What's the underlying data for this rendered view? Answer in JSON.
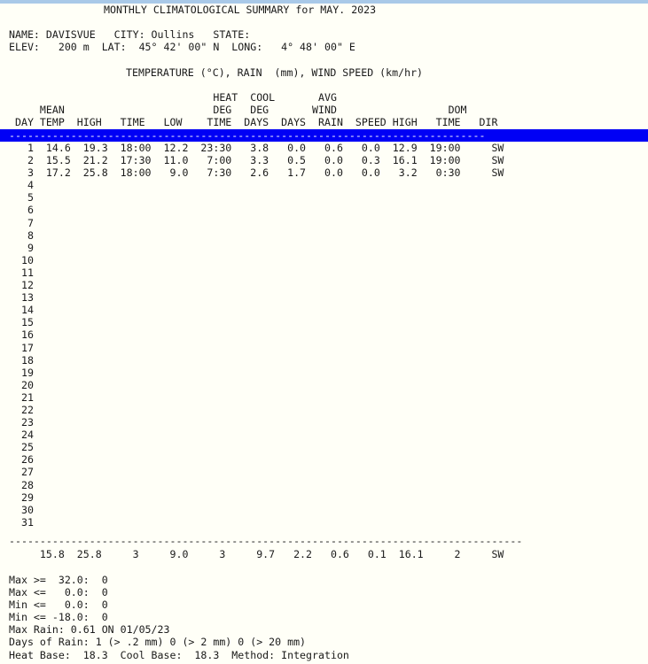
{
  "window": {
    "top_strip_color": "#a9c9e8",
    "background_color": "#fffff7",
    "text_color": "#1a1a1a",
    "selection_color": "#0000f5",
    "selection_text_color": "#ffffff"
  },
  "report": {
    "title": "MONTHLY CLIMATOLOGICAL SUMMARY for MAY. 2023",
    "station": {
      "name_label": "NAME:",
      "name_value": "DAVISVUE",
      "city_label": "CITY:",
      "city_value": "Oullins",
      "state_label": "STATE:",
      "state_value": "",
      "elev_label": "ELEV:",
      "elev_value": "200 m",
      "lat_label": "LAT:",
      "lat_value": "45° 42' 00\" N",
      "long_label": "LONG:",
      "long_value": "4° 48' 00\" E",
      "line1": "NAME: DAVISVUE   CITY: Oullins   STATE:",
      "line2": "ELEV:   200 m  LAT:  45° 42' 00\" N  LONG:   4° 48' 00\" E"
    },
    "units_line": "TEMPERATURE (°C), RAIN  (mm), WIND SPEED (km/hr)",
    "header_row_1": "                                 HEAT  COOL       AVG",
    "header_row_2": "     MEAN                        DEG   DEG       WIND                  DOM",
    "header_row_3": " DAY TEMP  HIGH   TIME   LOW    TIME  DAYS  DAYS  RAIN  SPEED HIGH   TIME   DIR",
    "separator_top": "-----------------------------------------------------------------------------",
    "separator_bottom": "-----------------------------------------------------------------------------------",
    "columns": [
      "DAY",
      "MEAN TEMP",
      "HIGH",
      "TIME",
      "LOW",
      "TIME",
      "HEAT DEG DAYS",
      "COOL DEG DAYS",
      "RAIN",
      "AVG WIND SPEED",
      "HIGH",
      "TIME",
      "DOM DIR"
    ],
    "rows": [
      {
        "day": "1",
        "mean_temp": "14.6",
        "high": "19.3",
        "high_time": "18:00",
        "low": "12.2",
        "low_time": "23:30",
        "heat_deg_days": "3.8",
        "cool_deg_days": "0.0",
        "rain": "0.6",
        "avg_wind_speed": "0.0",
        "wind_high": "12.9",
        "wind_time": "19:00",
        "dom_dir": "SW"
      },
      {
        "day": "2",
        "mean_temp": "15.5",
        "high": "21.2",
        "high_time": "17:30",
        "low": "11.0",
        "low_time": "7:00",
        "heat_deg_days": "3.3",
        "cool_deg_days": "0.5",
        "rain": "0.0",
        "avg_wind_speed": "0.3",
        "wind_high": "16.1",
        "wind_time": "19:00",
        "dom_dir": "SW"
      },
      {
        "day": "3",
        "mean_temp": "17.2",
        "high": "25.8",
        "high_time": "18:00",
        "low": "9.0",
        "low_time": "7:30",
        "heat_deg_days": "2.6",
        "cool_deg_days": "1.7",
        "rain": "0.0",
        "avg_wind_speed": "0.0",
        "wind_high": "3.2",
        "wind_time": "0:30",
        "dom_dir": "SW"
      },
      {
        "day": "4",
        "mean_temp": "",
        "high": "",
        "high_time": "",
        "low": "",
        "low_time": "",
        "heat_deg_days": "",
        "cool_deg_days": "",
        "rain": "",
        "avg_wind_speed": "",
        "wind_high": "",
        "wind_time": "",
        "dom_dir": ""
      },
      {
        "day": "5",
        "mean_temp": "",
        "high": "",
        "high_time": "",
        "low": "",
        "low_time": "",
        "heat_deg_days": "",
        "cool_deg_days": "",
        "rain": "",
        "avg_wind_speed": "",
        "wind_high": "",
        "wind_time": "",
        "dom_dir": ""
      },
      {
        "day": "6",
        "mean_temp": "",
        "high": "",
        "high_time": "",
        "low": "",
        "low_time": "",
        "heat_deg_days": "",
        "cool_deg_days": "",
        "rain": "",
        "avg_wind_speed": "",
        "wind_high": "",
        "wind_time": "",
        "dom_dir": ""
      },
      {
        "day": "7",
        "mean_temp": "",
        "high": "",
        "high_time": "",
        "low": "",
        "low_time": "",
        "heat_deg_days": "",
        "cool_deg_days": "",
        "rain": "",
        "avg_wind_speed": "",
        "wind_high": "",
        "wind_time": "",
        "dom_dir": ""
      },
      {
        "day": "8",
        "mean_temp": "",
        "high": "",
        "high_time": "",
        "low": "",
        "low_time": "",
        "heat_deg_days": "",
        "cool_deg_days": "",
        "rain": "",
        "avg_wind_speed": "",
        "wind_high": "",
        "wind_time": "",
        "dom_dir": ""
      },
      {
        "day": "9",
        "mean_temp": "",
        "high": "",
        "high_time": "",
        "low": "",
        "low_time": "",
        "heat_deg_days": "",
        "cool_deg_days": "",
        "rain": "",
        "avg_wind_speed": "",
        "wind_high": "",
        "wind_time": "",
        "dom_dir": ""
      },
      {
        "day": "10",
        "mean_temp": "",
        "high": "",
        "high_time": "",
        "low": "",
        "low_time": "",
        "heat_deg_days": "",
        "cool_deg_days": "",
        "rain": "",
        "avg_wind_speed": "",
        "wind_high": "",
        "wind_time": "",
        "dom_dir": ""
      },
      {
        "day": "11",
        "mean_temp": "",
        "high": "",
        "high_time": "",
        "low": "",
        "low_time": "",
        "heat_deg_days": "",
        "cool_deg_days": "",
        "rain": "",
        "avg_wind_speed": "",
        "wind_high": "",
        "wind_time": "",
        "dom_dir": ""
      },
      {
        "day": "12",
        "mean_temp": "",
        "high": "",
        "high_time": "",
        "low": "",
        "low_time": "",
        "heat_deg_days": "",
        "cool_deg_days": "",
        "rain": "",
        "avg_wind_speed": "",
        "wind_high": "",
        "wind_time": "",
        "dom_dir": ""
      },
      {
        "day": "13",
        "mean_temp": "",
        "high": "",
        "high_time": "",
        "low": "",
        "low_time": "",
        "heat_deg_days": "",
        "cool_deg_days": "",
        "rain": "",
        "avg_wind_speed": "",
        "wind_high": "",
        "wind_time": "",
        "dom_dir": ""
      },
      {
        "day": "14",
        "mean_temp": "",
        "high": "",
        "high_time": "",
        "low": "",
        "low_time": "",
        "heat_deg_days": "",
        "cool_deg_days": "",
        "rain": "",
        "avg_wind_speed": "",
        "wind_high": "",
        "wind_time": "",
        "dom_dir": ""
      },
      {
        "day": "15",
        "mean_temp": "",
        "high": "",
        "high_time": "",
        "low": "",
        "low_time": "",
        "heat_deg_days": "",
        "cool_deg_days": "",
        "rain": "",
        "avg_wind_speed": "",
        "wind_high": "",
        "wind_time": "",
        "dom_dir": ""
      },
      {
        "day": "16",
        "mean_temp": "",
        "high": "",
        "high_time": "",
        "low": "",
        "low_time": "",
        "heat_deg_days": "",
        "cool_deg_days": "",
        "rain": "",
        "avg_wind_speed": "",
        "wind_high": "",
        "wind_time": "",
        "dom_dir": ""
      },
      {
        "day": "17",
        "mean_temp": "",
        "high": "",
        "high_time": "",
        "low": "",
        "low_time": "",
        "heat_deg_days": "",
        "cool_deg_days": "",
        "rain": "",
        "avg_wind_speed": "",
        "wind_high": "",
        "wind_time": "",
        "dom_dir": ""
      },
      {
        "day": "18",
        "mean_temp": "",
        "high": "",
        "high_time": "",
        "low": "",
        "low_time": "",
        "heat_deg_days": "",
        "cool_deg_days": "",
        "rain": "",
        "avg_wind_speed": "",
        "wind_high": "",
        "wind_time": "",
        "dom_dir": ""
      },
      {
        "day": "19",
        "mean_temp": "",
        "high": "",
        "high_time": "",
        "low": "",
        "low_time": "",
        "heat_deg_days": "",
        "cool_deg_days": "",
        "rain": "",
        "avg_wind_speed": "",
        "wind_high": "",
        "wind_time": "",
        "dom_dir": ""
      },
      {
        "day": "20",
        "mean_temp": "",
        "high": "",
        "high_time": "",
        "low": "",
        "low_time": "",
        "heat_deg_days": "",
        "cool_deg_days": "",
        "rain": "",
        "avg_wind_speed": "",
        "wind_high": "",
        "wind_time": "",
        "dom_dir": ""
      },
      {
        "day": "21",
        "mean_temp": "",
        "high": "",
        "high_time": "",
        "low": "",
        "low_time": "",
        "heat_deg_days": "",
        "cool_deg_days": "",
        "rain": "",
        "avg_wind_speed": "",
        "wind_high": "",
        "wind_time": "",
        "dom_dir": ""
      },
      {
        "day": "22",
        "mean_temp": "",
        "high": "",
        "high_time": "",
        "low": "",
        "low_time": "",
        "heat_deg_days": "",
        "cool_deg_days": "",
        "rain": "",
        "avg_wind_speed": "",
        "wind_high": "",
        "wind_time": "",
        "dom_dir": ""
      },
      {
        "day": "23",
        "mean_temp": "",
        "high": "",
        "high_time": "",
        "low": "",
        "low_time": "",
        "heat_deg_days": "",
        "cool_deg_days": "",
        "rain": "",
        "avg_wind_speed": "",
        "wind_high": "",
        "wind_time": "",
        "dom_dir": ""
      },
      {
        "day": "24",
        "mean_temp": "",
        "high": "",
        "high_time": "",
        "low": "",
        "low_time": "",
        "heat_deg_days": "",
        "cool_deg_days": "",
        "rain": "",
        "avg_wind_speed": "",
        "wind_high": "",
        "wind_time": "",
        "dom_dir": ""
      },
      {
        "day": "25",
        "mean_temp": "",
        "high": "",
        "high_time": "",
        "low": "",
        "low_time": "",
        "heat_deg_days": "",
        "cool_deg_days": "",
        "rain": "",
        "avg_wind_speed": "",
        "wind_high": "",
        "wind_time": "",
        "dom_dir": ""
      },
      {
        "day": "26",
        "mean_temp": "",
        "high": "",
        "high_time": "",
        "low": "",
        "low_time": "",
        "heat_deg_days": "",
        "cool_deg_days": "",
        "rain": "",
        "avg_wind_speed": "",
        "wind_high": "",
        "wind_time": "",
        "dom_dir": ""
      },
      {
        "day": "27",
        "mean_temp": "",
        "high": "",
        "high_time": "",
        "low": "",
        "low_time": "",
        "heat_deg_days": "",
        "cool_deg_days": "",
        "rain": "",
        "avg_wind_speed": "",
        "wind_high": "",
        "wind_time": "",
        "dom_dir": ""
      },
      {
        "day": "28",
        "mean_temp": "",
        "high": "",
        "high_time": "",
        "low": "",
        "low_time": "",
        "heat_deg_days": "",
        "cool_deg_days": "",
        "rain": "",
        "avg_wind_speed": "",
        "wind_high": "",
        "wind_time": "",
        "dom_dir": ""
      },
      {
        "day": "29",
        "mean_temp": "",
        "high": "",
        "high_time": "",
        "low": "",
        "low_time": "",
        "heat_deg_days": "",
        "cool_deg_days": "",
        "rain": "",
        "avg_wind_speed": "",
        "wind_high": "",
        "wind_time": "",
        "dom_dir": ""
      },
      {
        "day": "30",
        "mean_temp": "",
        "high": "",
        "high_time": "",
        "low": "",
        "low_time": "",
        "heat_deg_days": "",
        "cool_deg_days": "",
        "rain": "",
        "avg_wind_speed": "",
        "wind_high": "",
        "wind_time": "",
        "dom_dir": ""
      },
      {
        "day": "31",
        "mean_temp": "",
        "high": "",
        "high_time": "",
        "low": "",
        "low_time": "",
        "heat_deg_days": "",
        "cool_deg_days": "",
        "rain": "",
        "avg_wind_speed": "",
        "wind_high": "",
        "wind_time": "",
        "dom_dir": ""
      }
    ],
    "totals": {
      "day": "",
      "mean_temp": "15.8",
      "high": "25.8",
      "high_time": "3",
      "low": "9.0",
      "low_time": "3",
      "heat_deg_days": "9.7",
      "cool_deg_days": "2.2",
      "rain": "0.6",
      "avg_wind_speed": "0.1",
      "wind_high": "16.1",
      "wind_time": "2",
      "dom_dir": "SW",
      "line": "     15.8  25.8     3     9.0     3     9.7   2.2   0.6   0.1  16.1     2     SW"
    },
    "footer": {
      "max_ge_label": "Max >=",
      "max_ge_value": "32.0:",
      "max_ge_count": "0",
      "max_le_label": "Max <=",
      "max_le_value": "0.0:",
      "max_le_count": "0",
      "min_le_label": "Min <=",
      "min_le_value": "0.0:",
      "min_le_count": "0",
      "min_le2_label": "Min <=",
      "min_le2_value": "-18.0:",
      "min_le2_count": "0",
      "max_rain": "Max Rain: 0.61 ON 01/05/23",
      "days_of_rain": "Days of Rain: 1 (> .2 mm) 0 (> 2 mm) 0 (> 20 mm)",
      "bases": "Heat Base:  18.3  Cool Base:  18.3  Method: Integration",
      "line_max_ge": "Max >=  32.0:  0",
      "line_max_le": "Max <=   0.0:  0",
      "line_min_le": "Min <=   0.0:  0",
      "line_min_le2": "Min <= -18.0:  0"
    },
    "selected_row_index": 0
  }
}
